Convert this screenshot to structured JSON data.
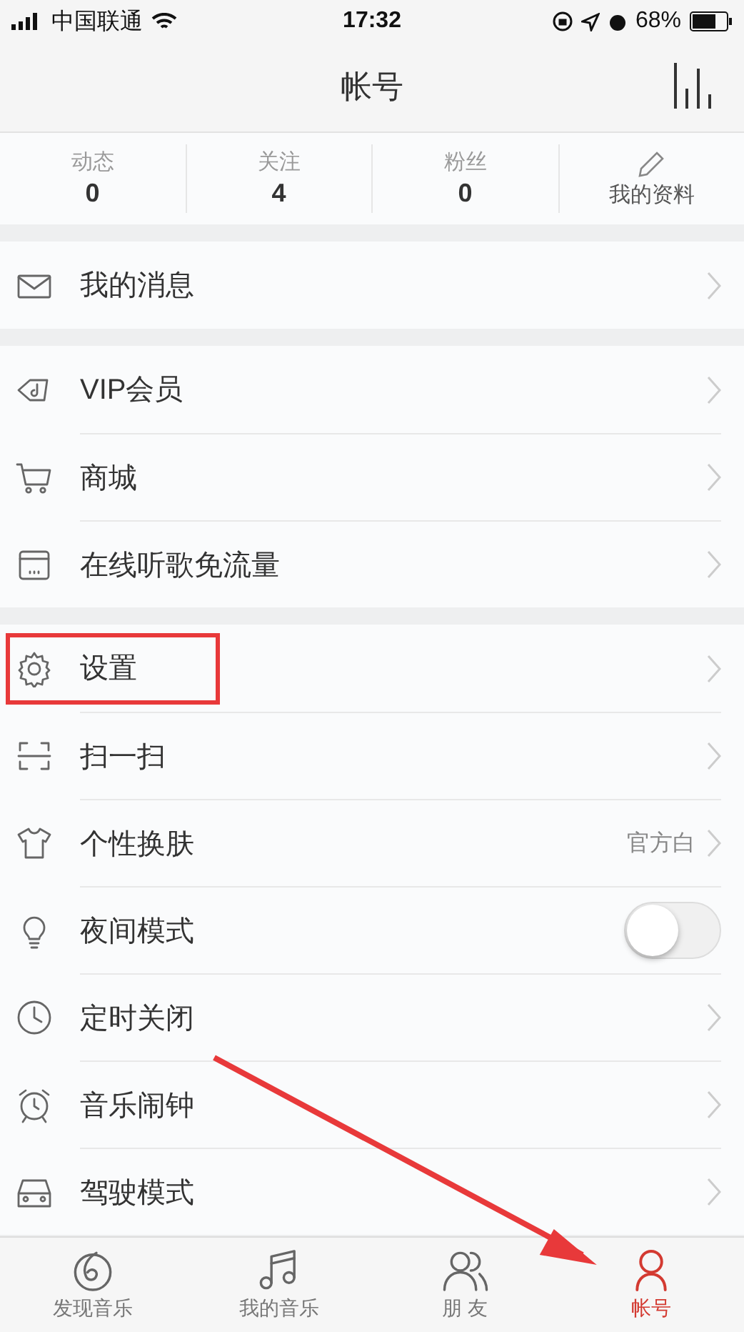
{
  "status_bar": {
    "carrier": "中国联通",
    "time": "17:32",
    "battery": "68%"
  },
  "nav_bar": {
    "title": "帐号"
  },
  "stats": [
    {
      "label": "动态",
      "value": "0"
    },
    {
      "label": "关注",
      "value": "4"
    },
    {
      "label": "粉丝",
      "value": "0"
    }
  ],
  "profile_link": {
    "label": "我的资料"
  },
  "sections": [
    {
      "items": [
        {
          "kind": "link",
          "label": "我的消息",
          "highlighted": false
        }
      ]
    },
    {
      "items": [
        {
          "kind": "link",
          "label": "VIP会员",
          "highlighted": false
        },
        {
          "kind": "link",
          "label": "商城",
          "highlighted": false
        },
        {
          "kind": "link",
          "label": "在线听歌免流量",
          "highlighted": false
        }
      ]
    },
    {
      "items": [
        {
          "kind": "link",
          "label": "设置",
          "highlighted": true
        },
        {
          "kind": "link",
          "label": "扫一扫",
          "highlighted": false
        },
        {
          "kind": "value",
          "label": "个性换肤",
          "value": "官方白",
          "highlighted": false
        },
        {
          "kind": "toggle",
          "label": "夜间模式",
          "on": false,
          "highlighted": false
        },
        {
          "kind": "link",
          "label": "定时关闭",
          "highlighted": false
        },
        {
          "kind": "link",
          "label": "音乐闹钟",
          "highlighted": false
        },
        {
          "kind": "link",
          "label": "驾驶模式",
          "highlighted": false
        }
      ]
    }
  ],
  "tabs": [
    {
      "label": "发现音乐",
      "selected": false
    },
    {
      "label": "我的音乐",
      "selected": false
    },
    {
      "label": "朋 友",
      "selected": false
    },
    {
      "label": "帐号",
      "selected": true
    }
  ],
  "annotation_arrow": true
}
